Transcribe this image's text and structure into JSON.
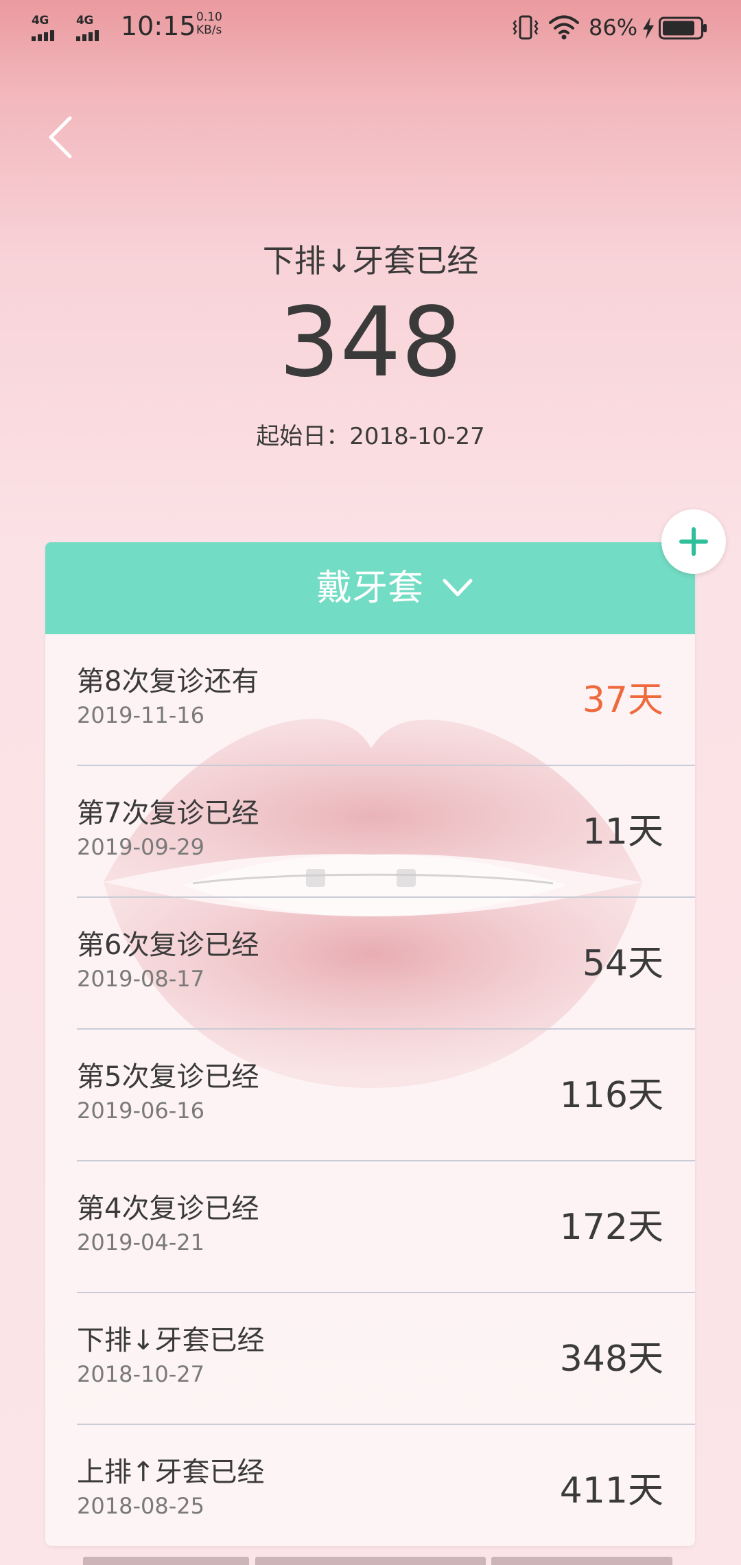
{
  "status_bar": {
    "network_1": "4G",
    "network_2": "4G",
    "time": "10:15",
    "speed_value": "0.10",
    "speed_unit": "KB/s",
    "battery_percent": "86%"
  },
  "header": {
    "title": "下排↓牙套已经",
    "count": "348",
    "start_date_text": "起始日：2018-10-27"
  },
  "card": {
    "header_label": "戴牙套",
    "items": [
      {
        "title": "第8次复诊还有",
        "date": "2019-11-16",
        "days": "37天",
        "highlight": true
      },
      {
        "title": "第7次复诊已经",
        "date": "2019-09-29",
        "days": "11天",
        "highlight": false
      },
      {
        "title": "第6次复诊已经",
        "date": "2019-08-17",
        "days": "54天",
        "highlight": false
      },
      {
        "title": "第5次复诊已经",
        "date": "2019-06-16",
        "days": "116天",
        "highlight": false
      },
      {
        "title": "第4次复诊已经",
        "date": "2019-04-21",
        "days": "172天",
        "highlight": false
      },
      {
        "title": "下排↓牙套已经",
        "date": "2018-10-27",
        "days": "348天",
        "highlight": false
      },
      {
        "title": "上排↑牙套已经",
        "date": "2018-08-25",
        "days": "411天",
        "highlight": false
      }
    ]
  },
  "icons": {
    "back": "back-chevron-icon",
    "add": "plus-icon",
    "dropdown": "chevron-down-icon",
    "wifi": "wifi-icon",
    "vibrate": "vibrate-icon",
    "battery": "battery-icon",
    "charging": "lightning-icon"
  },
  "colors": {
    "accent": "#73dcc4",
    "highlight": "#ee6a3c",
    "text": "#3a3a3a",
    "subtext": "#7a7a7a",
    "background_top": "#ea9a9f",
    "background_bottom": "#fbe5e8"
  }
}
